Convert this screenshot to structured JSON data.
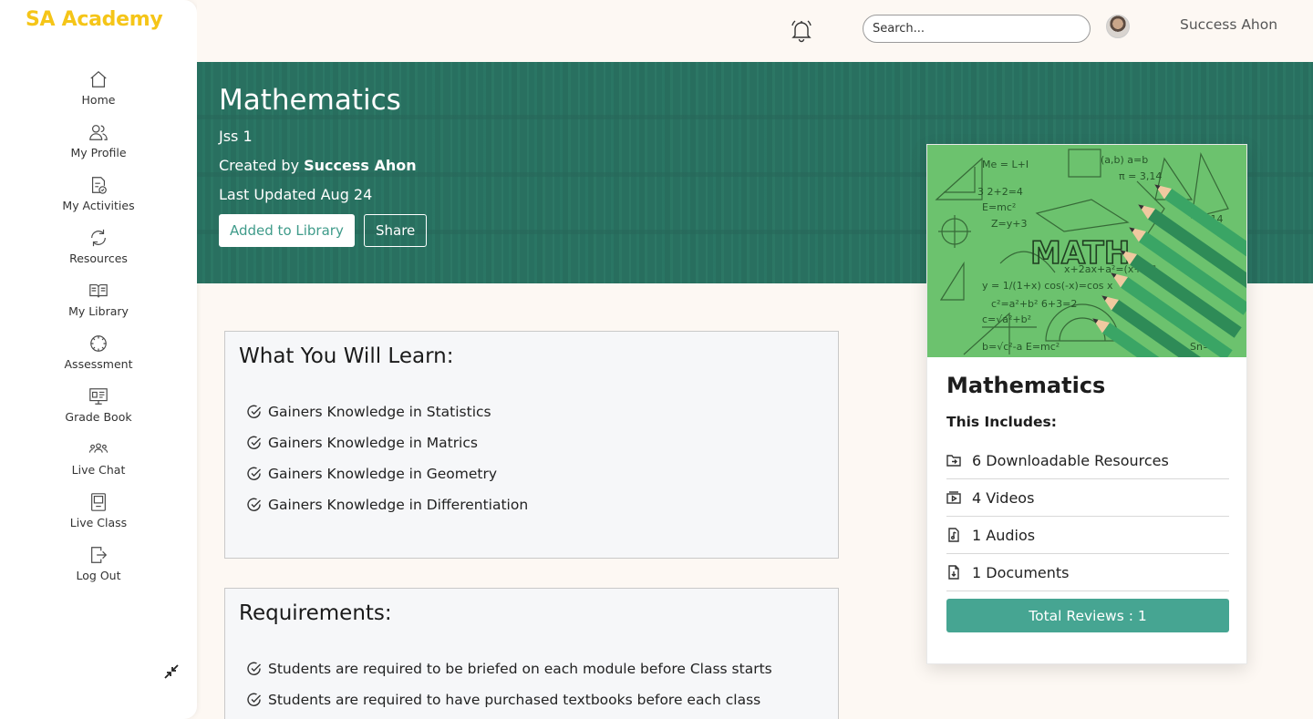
{
  "brand": {
    "name": "SA Academy",
    "color": "#f5c518"
  },
  "sidebar": {
    "items": [
      {
        "label": "Home",
        "icon": "home-icon"
      },
      {
        "label": "My Profile",
        "icon": "users-icon"
      },
      {
        "label": "My Activities",
        "icon": "activity-icon"
      },
      {
        "label": "Resources",
        "icon": "refresh-icon"
      },
      {
        "label": "My Library",
        "icon": "book-icon"
      },
      {
        "label": "Assessment",
        "icon": "dial-icon"
      },
      {
        "label": "Grade Book",
        "icon": "board-icon"
      },
      {
        "label": "Live Chat",
        "icon": "group-icon"
      },
      {
        "label": "Live Class",
        "icon": "screen-icon"
      },
      {
        "label": "Log Out",
        "icon": "logout-icon"
      }
    ],
    "collapse_icon": "collapse-arrows-icon"
  },
  "topbar": {
    "search_placeholder": "Search...",
    "username": "Success Ahon"
  },
  "hero": {
    "title": "Mathematics",
    "class_level": "Jss 1",
    "created_prefix": "Created by ",
    "creator": "Success Ahon",
    "last_updated": "Last Updated Aug 24",
    "library_button": "Added to Library",
    "share_button": "Share",
    "accent": "#2f7d6c"
  },
  "learn": {
    "title": "What You Will Learn:",
    "items": [
      "Gainers Knowledge in Statistics",
      "Gainers Knowledge in Matrics",
      "Gainers Knowledge in Geometry",
      "Gainers Knowledge in Differentiation"
    ]
  },
  "requirements": {
    "title": "Requirements:",
    "items": [
      "Students are required to be briefed on each module before Class starts",
      "Students are required to have purchased textbooks before each class"
    ]
  },
  "course_card": {
    "image_text": "MATH",
    "title": "Mathematics",
    "includes_label": "This Includes:",
    "includes": [
      {
        "label": "6 Downloadable Resources",
        "icon": "folder-icon"
      },
      {
        "label": "4 Videos",
        "icon": "video-icon"
      },
      {
        "label": "1 Audios",
        "icon": "audio-file-icon"
      },
      {
        "label": "1 Documents",
        "icon": "document-icon"
      }
    ],
    "reviews_button": "Total Reviews : 1",
    "button_color": "#46a592"
  }
}
